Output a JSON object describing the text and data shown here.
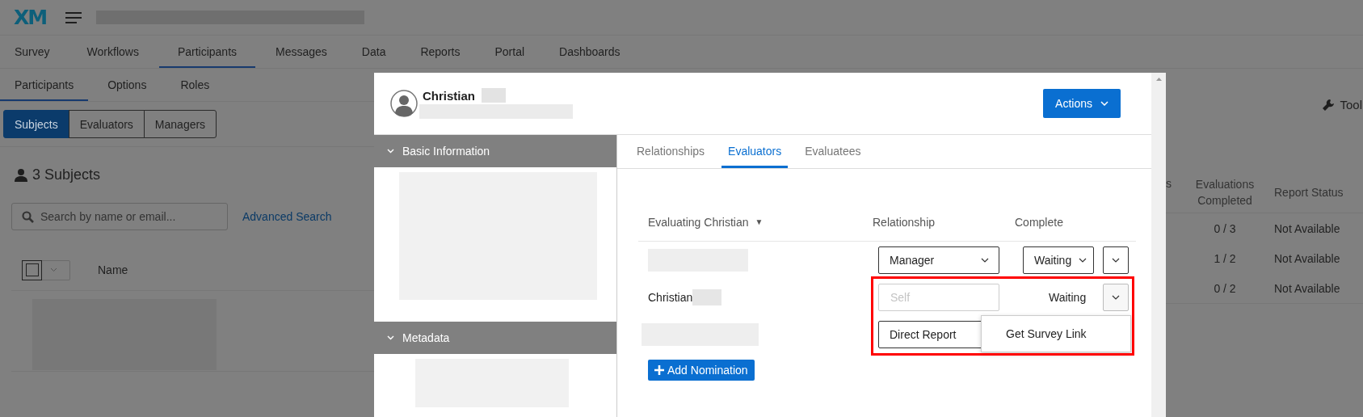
{
  "header": {
    "logo": "XM"
  },
  "top_nav": [
    {
      "label": "Survey",
      "selected": false
    },
    {
      "label": "Workflows",
      "selected": false
    },
    {
      "label": "Participants",
      "selected": true
    },
    {
      "label": "Messages",
      "selected": false
    },
    {
      "label": "Data",
      "selected": false
    },
    {
      "label": "Reports",
      "selected": false
    },
    {
      "label": "Portal",
      "selected": false
    },
    {
      "label": "Dashboards",
      "selected": false
    }
  ],
  "sub_nav": [
    {
      "label": "Participants",
      "selected": true
    },
    {
      "label": "Options",
      "selected": false
    },
    {
      "label": "Roles",
      "selected": false
    }
  ],
  "segments": [
    {
      "label": "Subjects",
      "selected": true
    },
    {
      "label": "Evaluators",
      "selected": false
    },
    {
      "label": "Managers",
      "selected": false
    }
  ],
  "subjects_heading": "3 Subjects",
  "select_all": {
    "checked": false
  },
  "search": {
    "placeholder": "Search by name or email..."
  },
  "advanced_search": "Advanced Search",
  "tools_label": "Tool",
  "table": {
    "columns": [
      "Name",
      "s",
      "Evaluations Completed",
      "Report Status"
    ],
    "rows": [
      {
        "evaluations_completed": "0 / 3",
        "report_status": "Not Available"
      },
      {
        "evaluations_completed": "1 / 2",
        "report_status": "Not Available"
      },
      {
        "evaluations_completed": "0 / 2",
        "report_status": "Not Available"
      }
    ]
  },
  "modal": {
    "name": "Christian",
    "actions_button": "Actions",
    "sections": [
      {
        "title": "Basic Information",
        "expanded": true
      },
      {
        "title": "Metadata",
        "expanded": true
      }
    ],
    "tabs": [
      {
        "label": "Relationships",
        "selected": false
      },
      {
        "label": "Evaluators",
        "selected": true
      },
      {
        "label": "Evaluatees",
        "selected": false
      }
    ],
    "evaluators": {
      "columns": [
        "Evaluating Christian",
        "Relationship",
        "Complete"
      ],
      "sort_indicator": "▼",
      "rows": [
        {
          "relationship": {
            "kind": "select",
            "value": "Manager"
          },
          "complete": {
            "kind": "select",
            "value": "Waiting"
          },
          "menu_open": false
        },
        {
          "name": "Christian",
          "relationship": {
            "kind": "disabled",
            "placeholder": "Self"
          },
          "complete": {
            "kind": "text",
            "value": "Waiting"
          },
          "menu_open": true
        },
        {
          "relationship": {
            "kind": "select",
            "value": "Direct Report"
          }
        }
      ]
    },
    "row_menu": [
      "Get Survey Link"
    ],
    "add_button": "Add Nomination"
  }
}
